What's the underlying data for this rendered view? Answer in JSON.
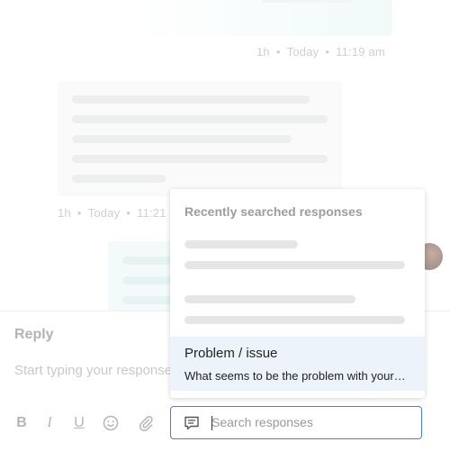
{
  "chat": {
    "messages": [
      {
        "age": "1h",
        "day": "Today",
        "time": "11:19 am"
      },
      {
        "age": "1h",
        "day": "Today",
        "time": "11:21"
      }
    ],
    "separator": "•"
  },
  "composer": {
    "tab_label": "Reply",
    "placeholder": "Start typing your response",
    "toolbar": {
      "bold": "B",
      "italic": "I",
      "underline": "U"
    }
  },
  "search": {
    "placeholder": "Search responses",
    "value": ""
  },
  "dropdown": {
    "header": "Recently searched responses",
    "results": [
      {
        "title": "Problem / issue",
        "text": "What seems to be the problem with your order?"
      }
    ]
  },
  "colors": {
    "accent": "#4a7fd0",
    "highlight": "#edf3fb",
    "muted": "#b5b5b5"
  },
  "icons": [
    "smiley-icon",
    "paperclip-icon",
    "chat-bubble-icon"
  ]
}
